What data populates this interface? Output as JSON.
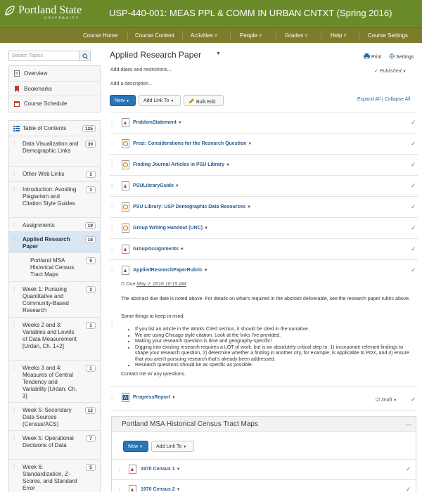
{
  "header": {
    "logo_name": "Portland State",
    "logo_sub": "UNIVERSITY",
    "course_title": "USP-440-001: MEAS PPL & COMM IN URBAN CNTXT (Spring 2016)",
    "bg_color": "#6b8a2a"
  },
  "nav": {
    "items": [
      "Course Home",
      "Course Content",
      "Activities ▿",
      "People ▿",
      "Grades ▿",
      "Help ▿",
      "Course Settings"
    ],
    "bg_color": "#7c7c2c"
  },
  "sidebar": {
    "search_placeholder": "Search Topics",
    "links": [
      "Overview",
      "Bookmarks",
      "Course Schedule"
    ],
    "toc": [
      {
        "label": "Table of Contents",
        "count": "125"
      },
      {
        "label": "Data Visualization and Demographic Links",
        "count": "39"
      },
      {
        "label": "Other Web Links",
        "count": "3"
      },
      {
        "label": "Introduction: Avoiding Plagiarism and Citation Style Guides",
        "count": "3"
      },
      {
        "label": "Assignments",
        "count": "19"
      },
      {
        "label": "Applied Research Paper",
        "count": "18"
      },
      {
        "label": "Portland MSA Historical Census Tract Maps",
        "count": "9"
      },
      {
        "label": "Week 1: Pursuing Quantitative and Community-Based Research",
        "count": "3"
      },
      {
        "label": "Weeks 2 and 3: Variables and Levels of Data Measurement [Urdan, Ch. 1+2]",
        "count": "1"
      },
      {
        "label": "Weeks 3 and 4: Measures of Central Tendency and Variability [Urdan, Ch. 3]",
        "count": "1"
      },
      {
        "label": "Week 5: Secondary Data Sources (Census/ACS)",
        "count": "12"
      },
      {
        "label": "Week 5: Operational Decisions of Data",
        "count": "7"
      },
      {
        "label": "Week 6: Standardization, Z-Scores, and Standard Error",
        "count": "5"
      }
    ]
  },
  "main": {
    "title": "Applied Research Paper",
    "print_label": "Print",
    "settings_label": "Settings",
    "dates_link": "Add dates and restrictions...",
    "published_label": "Published",
    "description_link": "Add a description...",
    "new_button": "New",
    "add_link_button": "Add Link To",
    "bulk_edit_button": "Bulk Edit",
    "expand_all": "Expand All",
    "collapse_all": "Collapse All",
    "items": [
      "ProblemStatement",
      "Prezi: Considerations for the Research Question",
      "Finding Journal Articles in PSU Library",
      "PSULibraryGuide",
      "PSU Library: USP Demographic Data Resources",
      "Group Writing Handout (UNC)",
      "GroupAssignments",
      "AppliedResearchPaperRubric"
    ],
    "due_prefix": "Due",
    "due_date": "May 2, 2016 10:15 AM",
    "abstract_text": "The abstract due date is noted above.  For details on what's required in the abstract deliverable, see the research paper rubric above.",
    "keep_in_mind": "Some things to keep in mind:",
    "bullets": [
      "If you list an article in the Works Cited section, it should be cited in the narrative.",
      "We are using Chicago style citation.  Look at the links I've provided.",
      "Making your research question is time and geography-specific!",
      "Digging into existing research requires a LOT of work, but is an absolutely critical step to: 1) incorporate relevant findings to shape your research question, 2) determine whether a finding in another city, for example, is applicable to PDX, and 3) ensure that you aren't pursuing research that's already been addressed.",
      "Research questions should be as specific as possible."
    ],
    "contact": "Contact me w/ any questions.",
    "progress_report": "ProgressReport",
    "draft_label": "Draft",
    "module": {
      "title": "Portland MSA Historical Census Tract Maps",
      "new_button": "New",
      "add_link_button": "Add Link To",
      "items": [
        "1970 Census 1",
        "1970 Census 2"
      ]
    }
  }
}
